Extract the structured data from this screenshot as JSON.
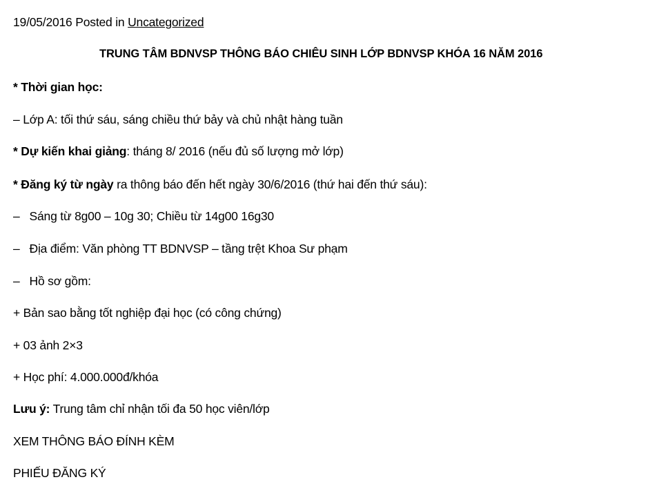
{
  "post": {
    "date": "19/05/2016",
    "posted_in": "Posted in",
    "category": "Uncategorized"
  },
  "title": "TRUNG TÂM BDNVSP THÔNG BÁO CHIÊU SINH LỚP BDNVSP KHÓA 16 NĂM 2016",
  "schedule": {
    "label": "* Thời gian học:",
    "class_a": "– Lớp A: tối thứ sáu, sáng chiều thứ bảy và chủ nhật hàng tuần"
  },
  "opening": {
    "label": "* Dự kiến khai giảng",
    "value": ": tháng 8/ 2016 (nếu đủ số lượng mở lớp)"
  },
  "registration": {
    "label": "* Đăng ký từ ngày",
    "value": " ra thông báo đến hết ngày 30/6/2016 (thứ hai đến thứ sáu):",
    "dash": "–",
    "hours": "Sáng từ 8g00 – 10g 30;  Chiều từ 14g00 16g30",
    "location": "Địa điểm: Văn phòng TT BDNVSP – tầng trệt Khoa Sư phạm",
    "documents": "Hồ sơ gồm:"
  },
  "documents_list": {
    "item1": "+ Bản sao bằng tốt nghiệp đại học (có công chứng)",
    "item2": "+ 03 ảnh 2×3",
    "item3": "+ Học phí: 4.000.000đ/khóa"
  },
  "note": {
    "label": "Lưu ý:",
    "value": " Trung tâm chỉ nhận tối đa 50 học viên/lớp"
  },
  "links": {
    "attachment": "XEM THÔNG BÁO ĐÍNH KÈM",
    "registration_form": "PHIẾU ĐĂNG KÝ"
  }
}
